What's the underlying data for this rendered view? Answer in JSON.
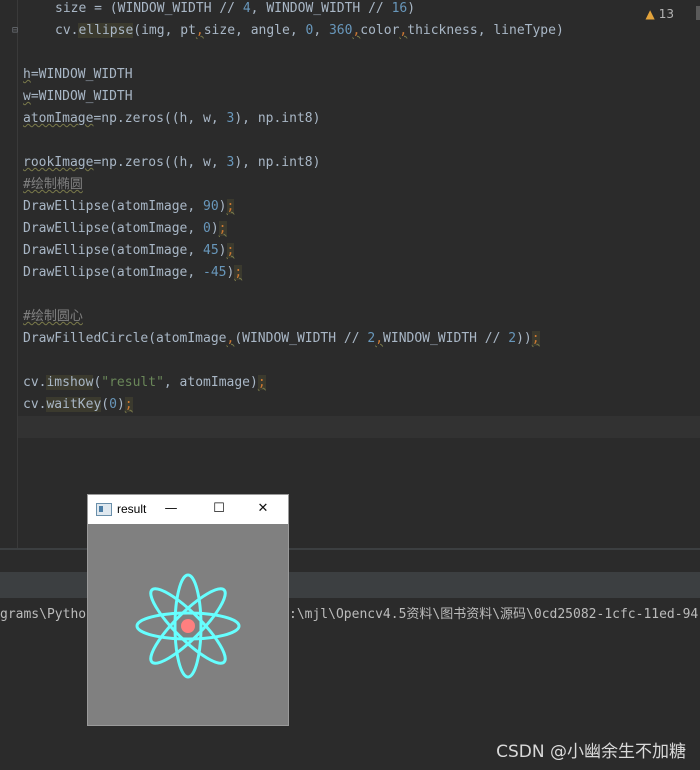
{
  "editor": {
    "lines": {
      "l1": {
        "a": "size = (WINDOW_WIDTH // ",
        "b": "4",
        "c": ", WINDOW_WIDTH // ",
        "d": "16",
        "e": ")"
      },
      "l2": {
        "a": "cv.",
        "fn": "ellipse",
        "b": "(img, pt",
        "c": ",",
        "d": "size, angle, ",
        "e": "0",
        "f": ", ",
        "g": "360",
        "h": ",",
        "i": "color",
        "j": ",",
        "k": "thickness, lineType)"
      },
      "l3": {
        "a": "h",
        "b": "=WINDOW_WIDTH"
      },
      "l4": {
        "a": "w",
        "b": "=WINDOW_WIDTH"
      },
      "l5": {
        "a": "atomImage",
        "b": "=np.zeros((h, w, ",
        "c": "3",
        "d": "), np.int8)"
      },
      "l6": {
        "a": "rookImage",
        "b": "=np.zeros((h, w, ",
        "c": "3",
        "d": "), np.int8)"
      },
      "l7": {
        "a": "#绘制椭圆"
      },
      "l8": {
        "a": "DrawEllipse(atomImage, ",
        "b": "90",
        "c": ")",
        "d": ";"
      },
      "l9": {
        "a": "DrawEllipse(atomImage, ",
        "b": "0",
        "c": ")",
        "d": ";"
      },
      "l10": {
        "a": "DrawEllipse(atomImage, ",
        "b": "45",
        "c": ")",
        "d": ";"
      },
      "l11": {
        "a": "DrawEllipse(atomImage, ",
        "b": "-45",
        "c": ")",
        "d": ";"
      },
      "l12": {
        "a": "#绘制圆心"
      },
      "l13": {
        "a": "DrawFilledCircle(atomImage",
        "b": ",",
        "c": "(WINDOW_WIDTH // ",
        "d": "2",
        "e": ",",
        "f": "WINDOW_WIDTH // ",
        "g": "2",
        "h": "))",
        "i": ";"
      },
      "l14": {
        "a": "cv.",
        "fn": "imshow",
        "b": "(",
        "c": "\"result\"",
        "d": ", atomImage)",
        "e": ";"
      },
      "l15": {
        "a": "cv.",
        "fn": "waitKey",
        "b": "(",
        "c": "0",
        "d": ")",
        "e": ";"
      }
    },
    "warnings": "13"
  },
  "run_panel": {
    "left_text": "grams\\Pytho",
    "right_text": ":\\mjl\\Opencv4.5资料\\图书资料\\源码\\0cd25082-1cfc-11ed-94"
  },
  "cv_window": {
    "title": "result",
    "minimize": "—",
    "maximize": "☐",
    "close": "✕"
  },
  "watermark": "CSDN @小幽余生不加糖",
  "colors": {
    "ellipse": "#66ffff",
    "center": "#ff7f7f",
    "canvas_bg": "#808080"
  }
}
